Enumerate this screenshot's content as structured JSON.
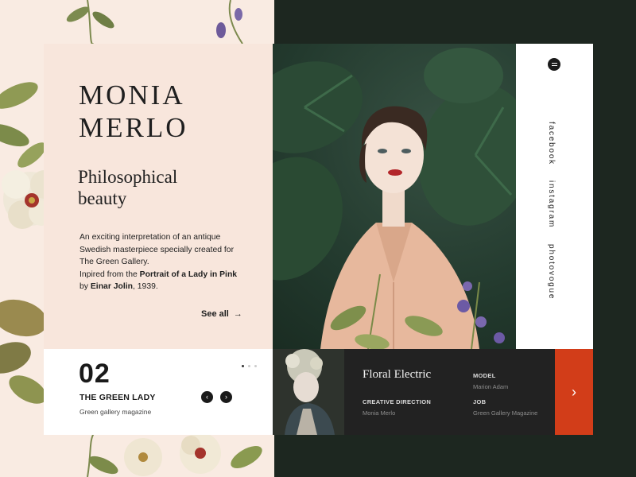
{
  "brand": {
    "line1": "MONIA",
    "line2": "MERLO"
  },
  "heading": {
    "line1": "Philosophical",
    "line2": "beauty"
  },
  "description": {
    "line1": "An exciting interpretation of an antique",
    "line2": "Swedish masterpiece specially created for",
    "line3": "The Green Gallery.",
    "line4_prefix": "Inpired from the ",
    "line4_bold": "Portrait of a Lady in Pink",
    "line5_prefix": "by ",
    "line5_bold": "Einar Jolin",
    "line5_suffix": ", 1939."
  },
  "see_all": {
    "label": "See all",
    "arrow": "→"
  },
  "social": {
    "items": [
      "facebook",
      "instagram",
      "photovogue"
    ],
    "menu_icon": "menu-icon"
  },
  "slider": {
    "number": "02",
    "title": "THE GREEN LADY",
    "subtitle": "Green gallery magazine",
    "prev": "‹",
    "next": "›",
    "page_count": 3,
    "active_page": 1
  },
  "feature": {
    "title": "Floral Electric",
    "model_label": "MODEL",
    "model_value": "Marion Adam",
    "creative_label": "CREATIVE DIRECTION",
    "creative_value": "Monia Merlo",
    "job_label": "JOB",
    "job_value": "Green Gallery Magazine",
    "next_arrow": "›"
  },
  "colors": {
    "accent": "#d23d19",
    "peach": "#f8e6dc",
    "dark_green": "#1d2720"
  }
}
